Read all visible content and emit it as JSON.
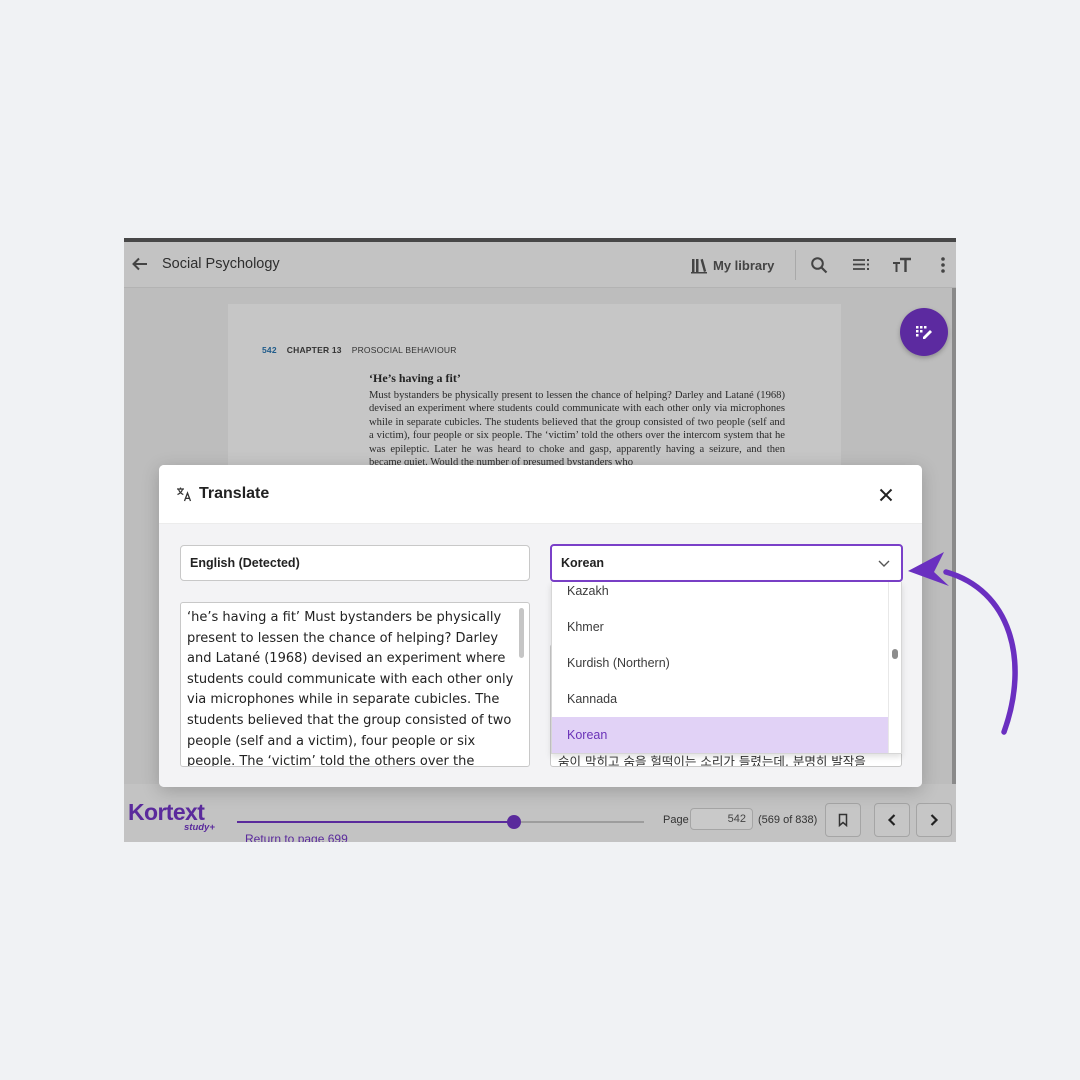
{
  "header": {
    "title": "Social Psychology",
    "library_label": "My library"
  },
  "page": {
    "number": "542",
    "chapter": "CHAPTER 13",
    "section": "PROSOCIAL BEHAVIOUR",
    "heading": "‘He’s having a fit’",
    "body": "Must bystanders be physically present to lessen the chance of helping? Darley and Latané (1968) devised an experiment where students could communicate with each other only via microphones while in separate cubicles. The students believed that the group consisted of two people (self and a victim), four people or six people. The ‘victim’ told the others over the intercom system that he was epileptic. Later he was heard to choke and gasp, apparently having a seizure, and then became quiet. Would the number of presumed bystanders who"
  },
  "translate": {
    "title": "Translate",
    "source_language": "English (Detected)",
    "target_language": "Korean",
    "source_text": "‘he’s having a fit’ Must bystanders be physically present to lessen the chance of helping? Darley and Latané (1968) devised an experiment where students could communicate with each other only via microphones while in separate cubicles. The students believed that the group consisted of two people (self and a victim), four people or six people. The ‘victim’ told the others over the",
    "target_text_visible": "숨이 막히고 숨을 헐떡이는 소리가 들렸는데, 분명히 발작을",
    "language_options": [
      "Kazakh",
      "Khmer",
      "Kurdish (Northern)",
      "Kannada",
      "Korean"
    ],
    "selected_option": "Korean"
  },
  "footer": {
    "brand": "Kortext",
    "brand_sub": "study+",
    "return_link": "Return to page 699",
    "page_label": "Page",
    "page_value": "542",
    "page_count": "(569 of 838)",
    "progress_fraction": 0.68
  },
  "colors": {
    "accent": "#5a2a9c",
    "selected_bg": "#e1d2f6",
    "annotation_arrow": "#6a2fc0"
  },
  "icons": [
    "back-arrow-icon",
    "library-icon",
    "search-icon",
    "contents-icon",
    "text-size-icon",
    "more-vert-icon",
    "annotate-icon",
    "translate-icon",
    "close-icon",
    "chevron-down-icon",
    "bookmark-icon",
    "chevron-left-icon",
    "chevron-right-icon"
  ]
}
